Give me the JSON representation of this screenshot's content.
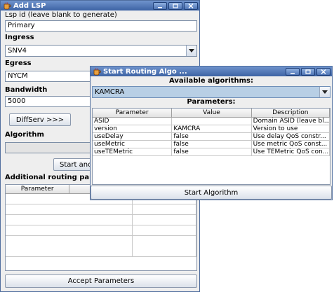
{
  "add_lsp": {
    "title": "Add LSP",
    "lsp_id_label": "Lsp id (leave blank to generate)",
    "lsp_id_value": "Primary",
    "ingress_label": "Ingress",
    "ingress_value": "SNV4",
    "egress_label": "Egress",
    "egress_value": "NYCM",
    "bandwidth_label": "Bandwidth",
    "bandwidth_value": "5000",
    "diffserv_button": "DiffServ >>>",
    "algorithm_label": "Algorithm",
    "algorithm_value": "",
    "start_button": "Start ano",
    "additional_params_label": "Additional routing param",
    "params_table": {
      "columns": [
        "Parameter",
        ""
      ]
    },
    "accept_button": "Accept Parameters"
  },
  "routing_dialog": {
    "title": "Start Routing Algo ...",
    "available_label": "Available algorithms:",
    "selected_algorithm": "KAMCRA",
    "parameters_label": "Parameters:",
    "columns": [
      "Parameter",
      "Value",
      "Description"
    ],
    "rows": [
      {
        "parameter": "ASID",
        "value": "",
        "description": "Domain ASID (leave bl..."
      },
      {
        "parameter": "version",
        "value": "KAMCRA",
        "description": "Version to use"
      },
      {
        "parameter": "useDelay",
        "value": "false",
        "description": "Use delay QoS constr..."
      },
      {
        "parameter": "useMetric",
        "value": "false",
        "description": "Use metric QoS const..."
      },
      {
        "parameter": "useTEMetric",
        "value": "false",
        "description": "Use TEMetric QoS con..."
      }
    ],
    "start_button": "Start Algorithm"
  },
  "colors": {
    "titlebar": "#3d63a4",
    "selection": "#b8cfe5",
    "window_bg": "#eeeeee"
  },
  "icons": {
    "app": "java-cup-icon",
    "minimize": "minimize-icon",
    "maximize": "maximize-icon",
    "close": "close-icon",
    "dropdown": "chevron-down-icon"
  }
}
